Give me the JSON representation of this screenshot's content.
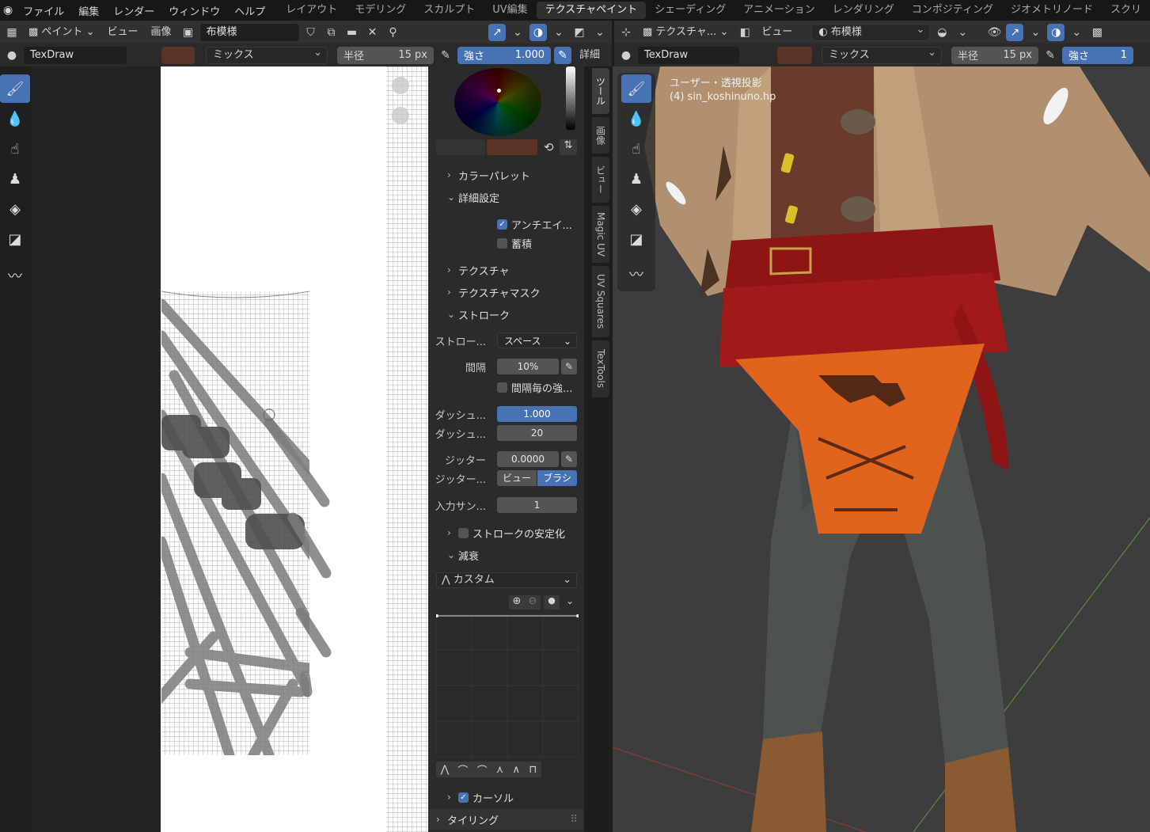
{
  "menubar": {
    "items": [
      "ファイル",
      "編集",
      "レンダー",
      "ウィンドウ",
      "ヘルプ"
    ],
    "workspaces": [
      "レイアウト",
      "モデリング",
      "スカルプト",
      "UV編集",
      "テクスチャペイント",
      "シェーディング",
      "アニメーション",
      "レンダリング",
      "コンポジティング",
      "ジオメトリノード",
      "スクリ"
    ],
    "active_workspace": "テクスチャペイント"
  },
  "image_editor": {
    "header": {
      "mode": "ペイント",
      "view": "ビュー",
      "image": "画像",
      "image_name": "布模様"
    },
    "tool_settings": {
      "brush_name": "TexDraw",
      "color_hex": "#5a3326",
      "blend_mode": "ミックス",
      "radius_label": "半径",
      "radius_value": "15 px",
      "strength_label": "強さ",
      "strength_value": "1.000",
      "details_label": "詳細"
    }
  },
  "properties": {
    "color_palette": "カラーパレット",
    "advanced": "詳細設定",
    "antialias": "アンチエイ...",
    "accumulate": "蓄積",
    "texture": "テクスチャ",
    "texture_mask": "テクスチャマスク",
    "stroke": "ストローク",
    "stroke_method_label": "ストロー...",
    "stroke_method_value": "スペース",
    "spacing_label": "間隔",
    "spacing_value": "10%",
    "spacing_pressure": "間隔毎の強...",
    "dash_ratio_label": "ダッシュ...",
    "dash_ratio_value": "1.000",
    "dash_length_label": "ダッシュ...",
    "dash_length_value": "20",
    "jitter_label": "ジッター",
    "jitter_value": "0.0000",
    "jitter_space_label": "ジッター...",
    "jitter_view": "ビュー",
    "jitter_brush": "ブラシ",
    "input_samples_label": "入力サン...",
    "input_samples_value": "1",
    "stabilize": "ストロークの安定化",
    "falloff": "減衰",
    "falloff_preset": "カスタム",
    "cursor": "カーソル",
    "tiling": "タイリング"
  },
  "sidebar_tabs": [
    "ツール",
    "画像",
    "ビュー",
    "Magic UV",
    "UV Squares",
    "TexTools"
  ],
  "viewport": {
    "header": {
      "mode": "テクスチャ...",
      "view": "ビュー",
      "material_name": "布模様"
    },
    "tool_settings": {
      "brush_name": "TexDraw",
      "blend_mode": "ミックス",
      "radius_label": "半径",
      "radius_value": "15 px",
      "strength_label": "強さ",
      "strength_value": "1"
    },
    "overlay_line1": "ユーザー・透視投影",
    "overlay_line2": "(4) sin_koshinuno.hp"
  },
  "colors": {
    "accent": "#4772b3",
    "brush_color": "#5a3326",
    "cloth_orange": "#e0641c",
    "belt_red": "#8f1414"
  }
}
